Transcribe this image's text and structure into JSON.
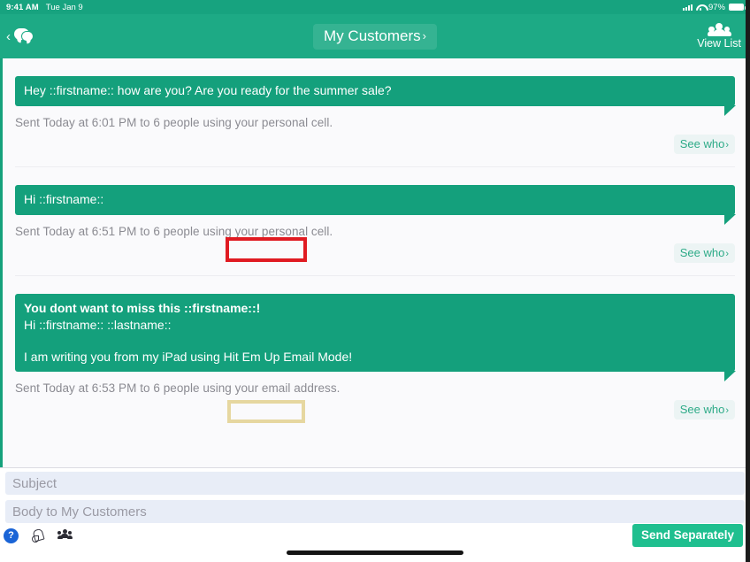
{
  "status_bar": {
    "time": "9:41 AM",
    "date": "Tue Jan 9",
    "battery_percent": "97%",
    "signal_icon": "cellular-signal-icon",
    "wifi_icon": "wifi-icon",
    "battery_icon": "battery-icon"
  },
  "nav": {
    "back_icon": "chevron-left-icon",
    "messages_icon": "chat-bubbles-icon",
    "title": "My Customers",
    "title_chevron": "›",
    "view_list_label": "View List",
    "view_list_icon": "people-group-icon"
  },
  "accent": {
    "header_green": "#1daa85",
    "bubble_green": "#14a07c",
    "send_green": "#1fbf8f",
    "link_green": "#2eab88",
    "annotation_red": "#e01b22",
    "annotation_gold": "#e6d7a0",
    "field_blue": "#e8edf7",
    "help_blue": "#1a64d6"
  },
  "messages": [
    {
      "lines": [
        "Hey ::firstname:: how are you? Are you ready for the summer sale?"
      ],
      "bold_first_line": false,
      "blank_after_first_block": false,
      "sent_info": "Sent Today at 6:01 PM to 6 people using your personal cell.",
      "see_who_label": "See who",
      "see_who_chevron": "›",
      "annotation": "none"
    },
    {
      "lines": [
        "Hi ::firstname::"
      ],
      "bold_first_line": false,
      "blank_after_first_block": false,
      "sent_info": "Sent Today at 6:51 PM to 6 people using your personal cell.",
      "see_who_label": "See who",
      "see_who_chevron": "›",
      "annotation": "red",
      "annotation_target": "personal cell."
    },
    {
      "lines": [
        "You dont want to miss this ::firstname::!",
        "Hi ::firstname:: ::lastname::",
        "",
        "I am writing you from my iPad using Hit Em Up Email Mode!"
      ],
      "bold_first_line": true,
      "blank_after_first_block": true,
      "sent_info": "Sent Today at 6:53 PM to 6 people using your email address.",
      "see_who_label": "See who",
      "see_who_chevron": "›",
      "annotation": "gold",
      "annotation_target": "email address."
    }
  ],
  "compose": {
    "subject_placeholder": "Subject",
    "subject_value": "",
    "body_placeholder": "Body to My Customers",
    "body_value": "",
    "help_icon_label": "?",
    "help_icon": "help-question-icon",
    "attach_icon": "attachment-icon",
    "recipients_icon": "people-group-icon",
    "send_label": "Send Separately"
  }
}
